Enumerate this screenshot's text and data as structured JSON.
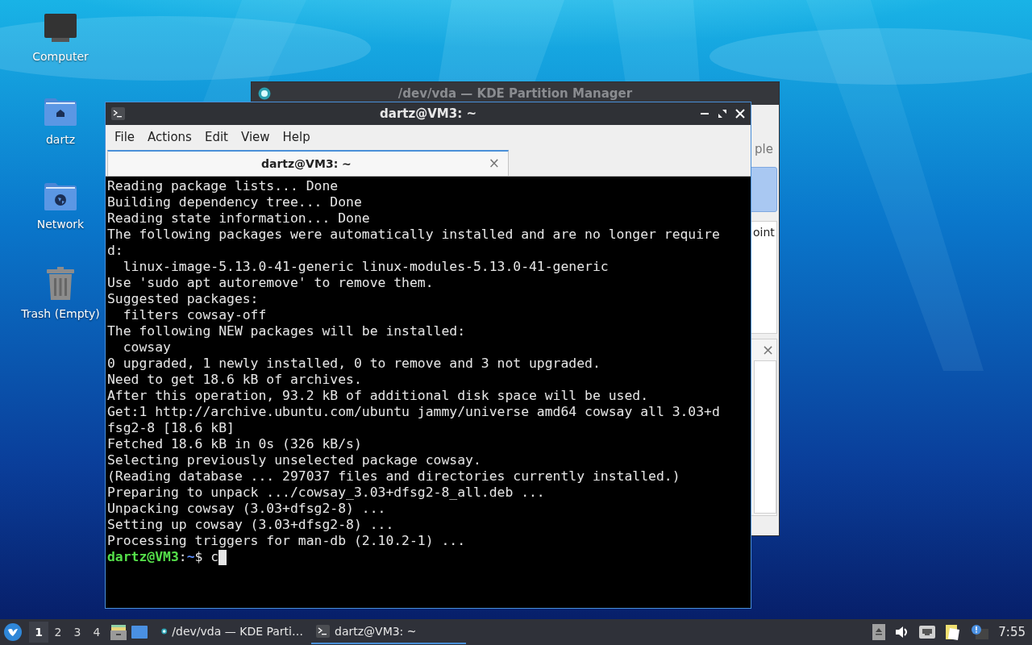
{
  "desktop_icons": [
    {
      "kind": "computer",
      "label": "Computer"
    },
    {
      "kind": "home",
      "label": "dartz"
    },
    {
      "kind": "network",
      "label": "Network"
    },
    {
      "kind": "trash",
      "label": "Trash (Empty)"
    }
  ],
  "background_window": {
    "title": "/dev/vda — KDE Partition Manager",
    "texts": [
      "ple",
      "oint"
    ],
    "close_glyph": "×"
  },
  "terminal": {
    "title": "dartz@VM3: ~",
    "menu": [
      "File",
      "Actions",
      "Edit",
      "View",
      "Help"
    ],
    "tabs": [
      {
        "label": "dartz@VM3: ~",
        "selected": true,
        "close_glyph": "×"
      }
    ],
    "lines": [
      {
        "kind": "output",
        "text": "Reading package lists... Done"
      },
      {
        "kind": "output",
        "text": "Building dependency tree... Done"
      },
      {
        "kind": "output",
        "text": "Reading state information... Done"
      },
      {
        "kind": "output",
        "text": "The following packages were automatically installed and are no longer require"
      },
      {
        "kind": "output",
        "text": "d:"
      },
      {
        "kind": "output",
        "text": "  linux-image-5.13.0-41-generic linux-modules-5.13.0-41-generic"
      },
      {
        "kind": "output",
        "text": "Use 'sudo apt autoremove' to remove them."
      },
      {
        "kind": "output",
        "text": "Suggested packages:"
      },
      {
        "kind": "output",
        "text": "  filters cowsay-off"
      },
      {
        "kind": "output",
        "text": "The following NEW packages will be installed:"
      },
      {
        "kind": "output",
        "text": "  cowsay"
      },
      {
        "kind": "output",
        "text": "0 upgraded, 1 newly installed, 0 to remove and 3 not upgraded."
      },
      {
        "kind": "output",
        "text": "Need to get 18.6 kB of archives."
      },
      {
        "kind": "output",
        "text": "After this operation, 93.2 kB of additional disk space will be used."
      },
      {
        "kind": "output",
        "text": "Get:1 http://archive.ubuntu.com/ubuntu jammy/universe amd64 cowsay all 3.03+d"
      },
      {
        "kind": "output",
        "text": "fsg2-8 [18.6 kB]"
      },
      {
        "kind": "output",
        "text": "Fetched 18.6 kB in 0s (326 kB/s)"
      },
      {
        "kind": "output",
        "text": "Selecting previously unselected package cowsay."
      },
      {
        "kind": "output",
        "text": "(Reading database ... 297037 files and directories currently installed.)"
      },
      {
        "kind": "output",
        "text": "Preparing to unpack .../cowsay_3.03+dfsg2-8_all.deb ..."
      },
      {
        "kind": "output",
        "text": "Unpacking cowsay (3.03+dfsg2-8) ..."
      },
      {
        "kind": "output",
        "text": "Setting up cowsay (3.03+dfsg2-8) ..."
      },
      {
        "kind": "output",
        "text": "Processing triggers for man-db (2.10.2-1) ..."
      },
      {
        "kind": "prompt",
        "user": "dartz@VM3",
        "separator": ":",
        "path": "~",
        "symbol": "$",
        "command": "c"
      }
    ]
  },
  "taskbar": {
    "workspaces": [
      {
        "label": "1",
        "selected": true
      },
      {
        "label": "2",
        "selected": false
      },
      {
        "label": "3",
        "selected": false
      },
      {
        "label": "4",
        "selected": false
      }
    ],
    "tasks": [
      {
        "kind": "partition",
        "label": "/dev/vda — KDE Parti…",
        "selected": false
      },
      {
        "kind": "terminal",
        "label": "dartz@VM3: ~",
        "selected": true
      }
    ],
    "clock": "7:55"
  }
}
